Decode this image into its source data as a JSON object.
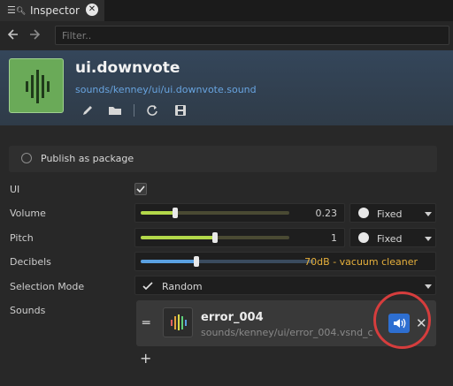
{
  "tab": {
    "title": "Inspector",
    "icon": "inspector-icon",
    "close": "✕"
  },
  "toolbar": {
    "filter_placeholder": "Filter.."
  },
  "asset": {
    "name": "ui.downvote",
    "path": "sounds/kenney/ui/ui.downvote.sound",
    "thumb_color": "#6aaa58"
  },
  "publish": {
    "label": "Publish as package",
    "checked": false
  },
  "props": {
    "ui": {
      "label": "UI",
      "checked": true
    },
    "volume": {
      "label": "Volume",
      "value": "0.23",
      "fill": 0.23,
      "mode": "Fixed"
    },
    "pitch": {
      "label": "Pitch",
      "value": "1",
      "fill": 0.5,
      "mode": "Fixed"
    },
    "decibels": {
      "label": "Decibels",
      "value": "70dB - vacuum cleaner",
      "fill": 0.32,
      "accent": "#e6b03c"
    },
    "selection_mode": {
      "label": "Selection Mode",
      "value": "Random"
    },
    "sounds": {
      "label": "Sounds",
      "items": [
        {
          "name": "error_004",
          "path": "sounds/kenney/ui/error_004.vsnd_c"
        }
      ]
    }
  },
  "colors": {
    "accent": "#2e6fd1",
    "slider": "#b3d84a",
    "decibel_slider": "#5aa0e0",
    "highlight_ring": "#d63d3d"
  }
}
